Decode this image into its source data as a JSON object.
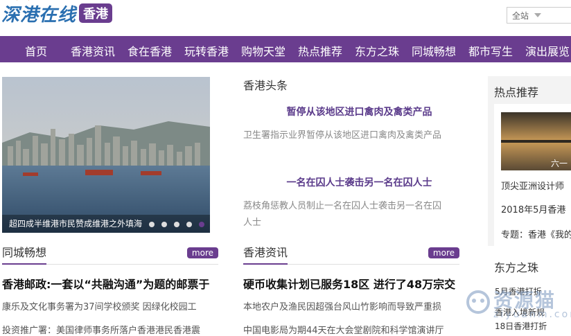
{
  "header": {
    "logo_text": "深港在线",
    "logo_badge": "香港",
    "search_scope": "全站"
  },
  "nav": {
    "items": [
      "首页",
      "香港资讯",
      "食在香港",
      "玩转香港",
      "购物天堂",
      "热点推荐",
      "东方之珠",
      "同城畅想",
      "都市写生",
      "演出展览"
    ]
  },
  "slider": {
    "caption": "超四成半维港市民赞成维港之外填海",
    "dot_count": 5,
    "active_dot": 5
  },
  "headlines": {
    "section_title": "香港头条",
    "items": [
      {
        "title": "暂停从该地区进口禽肉及禽类产品",
        "summary": "卫生署指示业界暂停从该地区进口禽肉及禽类产品"
      },
      {
        "title": "一名在囚人士袭击另一名在囚人士",
        "summary_lines": [
          "荔枝角惩教人员制止一名在囚人士袭击另一名在囚",
          "人士"
        ]
      }
    ]
  },
  "hot": {
    "title": "热点推荐",
    "thumb_caption": "六一",
    "line1": "顶尖亚洲设计师",
    "line2": "2018年5月香港",
    "line3": "专题：香港《我的"
  },
  "city": {
    "title": "同城畅想",
    "more": "more",
    "lead": "香港邮政:一套以“共融沟通”为题的邮票于",
    "lines": [
      "康乐及文化事务署为37间学校颁奖 因绿化校园工",
      "投资推广署：美国律师事务所落户香港港民香港震"
    ]
  },
  "news": {
    "title": "香港资讯",
    "more": "more",
    "lead": "硬币收集计划已服务18区 进行了48万宗交",
    "lines": [
      "本地农户及渔民因超强台风山竹影响而导致严重损",
      "中国电影局为期44天在大会堂剧院和科学馆演讲厅"
    ]
  },
  "pearl": {
    "title": "东方之珠",
    "items": [
      "5月香港打折",
      "香港入境新规",
      "18日香港打折"
    ]
  },
  "watermark": {
    "text": "资源猫",
    "sub": "ziyuanm.com"
  },
  "colors": {
    "brand": "#6a3d8f",
    "logo_blue": "#2a6fb0",
    "accent_orange": "#e38b2c"
  }
}
